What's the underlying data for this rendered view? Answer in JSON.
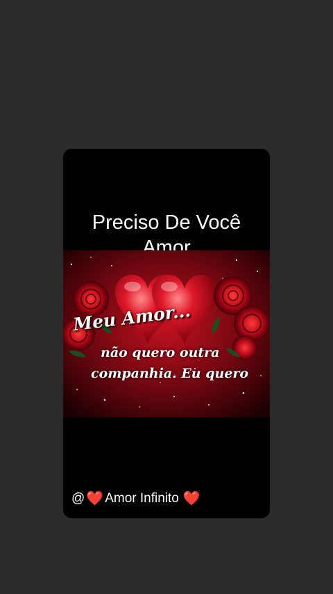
{
  "post": {
    "title_line1": "Preciso De Você",
    "title_line2": "Amor",
    "image_text_heading": "Meu Amor...",
    "image_text_line1": "não quero outra",
    "image_text_line2": "companhia. Eu quero",
    "handle_prefix": "@",
    "handle_name": "Amor Infinito",
    "heart_glyph": "❤️"
  },
  "colors": {
    "page_background": "#2b2b2b",
    "card_background": "#000000",
    "heart_red": "#e0203a",
    "image_red": "#8a0a18"
  },
  "icons": [
    "heart-icon",
    "rose-icon"
  ]
}
